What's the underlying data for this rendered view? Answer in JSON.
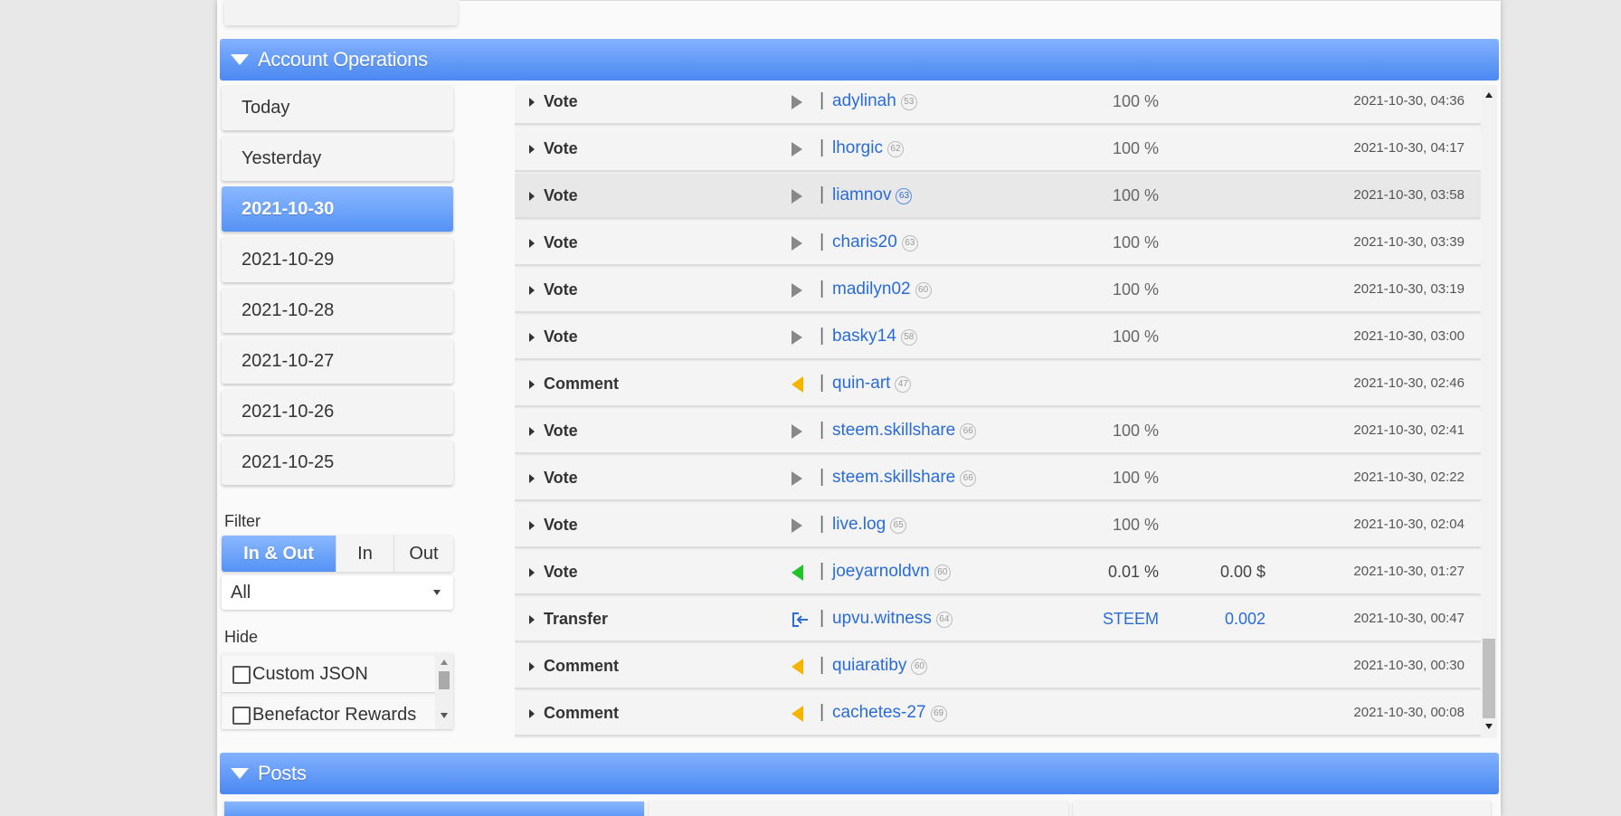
{
  "sections": {
    "account_operations": "Account Operations",
    "posts": "Posts"
  },
  "sidebar": {
    "days": [
      {
        "label": "Today",
        "active": false
      },
      {
        "label": "Yesterday",
        "active": false
      },
      {
        "label": "2021-10-30",
        "active": true
      },
      {
        "label": "2021-10-29",
        "active": false
      },
      {
        "label": "2021-10-28",
        "active": false
      },
      {
        "label": "2021-10-27",
        "active": false
      },
      {
        "label": "2021-10-26",
        "active": false
      },
      {
        "label": "2021-10-25",
        "active": false
      }
    ],
    "filter_label": "Filter",
    "filter_options": [
      "In & Out",
      "In",
      "Out"
    ],
    "filter_selected": "In & Out",
    "type_select": "All",
    "hide_label": "Hide",
    "hide_items": [
      {
        "label": "Custom JSON",
        "checked": false
      },
      {
        "label": "Benefactor Rewards",
        "checked": false
      }
    ]
  },
  "operations": [
    {
      "type": "Vote",
      "direction": "out-gray",
      "account": "adylinah",
      "rep": "53",
      "percent": "100 %",
      "amount": "",
      "time": "2021-10-30, 04:36"
    },
    {
      "type": "Vote",
      "direction": "out-gray",
      "account": "lhorgic",
      "rep": "62",
      "percent": "100 %",
      "amount": "",
      "time": "2021-10-30, 04:17"
    },
    {
      "type": "Vote",
      "direction": "out-gray",
      "account": "liamnov",
      "rep": "63",
      "percent": "100 %",
      "amount": "",
      "time": "2021-10-30, 03:58",
      "highlighted": true
    },
    {
      "type": "Vote",
      "direction": "out-gray",
      "account": "charis20",
      "rep": "63",
      "percent": "100 %",
      "amount": "",
      "time": "2021-10-30, 03:39"
    },
    {
      "type": "Vote",
      "direction": "out-gray",
      "account": "madilyn02",
      "rep": "60",
      "percent": "100 %",
      "amount": "",
      "time": "2021-10-30, 03:19"
    },
    {
      "type": "Vote",
      "direction": "out-gray",
      "account": "basky14",
      "rep": "58",
      "percent": "100 %",
      "amount": "",
      "time": "2021-10-30, 03:00"
    },
    {
      "type": "Comment",
      "direction": "in-yellow",
      "account": "quin-art",
      "rep": "47",
      "percent": "",
      "amount": "",
      "time": "2021-10-30, 02:46"
    },
    {
      "type": "Vote",
      "direction": "out-gray",
      "account": "steem.skillshare",
      "rep": "66",
      "percent": "100 %",
      "amount": "",
      "time": "2021-10-30, 02:41"
    },
    {
      "type": "Vote",
      "direction": "out-gray",
      "account": "steem.skillshare",
      "rep": "66",
      "percent": "100 %",
      "amount": "",
      "time": "2021-10-30, 02:22"
    },
    {
      "type": "Vote",
      "direction": "out-gray",
      "account": "live.log",
      "rep": "65",
      "percent": "100 %",
      "amount": "",
      "time": "2021-10-30, 02:04"
    },
    {
      "type": "Vote",
      "direction": "in-green",
      "account": "joeyarnoldvn",
      "rep": "60",
      "percent": "0.01 %",
      "amount": "0.00 $",
      "time": "2021-10-30, 01:27"
    },
    {
      "type": "Transfer",
      "direction": "transfer-in",
      "account": "upvu.witness",
      "rep": "64",
      "percent": "STEEM",
      "amount": "0.002",
      "time": "2021-10-30, 00:47"
    },
    {
      "type": "Comment",
      "direction": "in-yellow",
      "account": "quiaratiby",
      "rep": "60",
      "percent": "",
      "amount": "",
      "time": "2021-10-30, 00:30"
    },
    {
      "type": "Comment",
      "direction": "in-yellow",
      "account": "cachetes-27",
      "rep": "69",
      "percent": "",
      "amount": "",
      "time": "2021-10-30, 00:08"
    }
  ],
  "colors": {
    "accent": "#5592f5",
    "link": "#2a6cd6",
    "vote_in": "#22c32a",
    "comment": "#f5b400"
  }
}
